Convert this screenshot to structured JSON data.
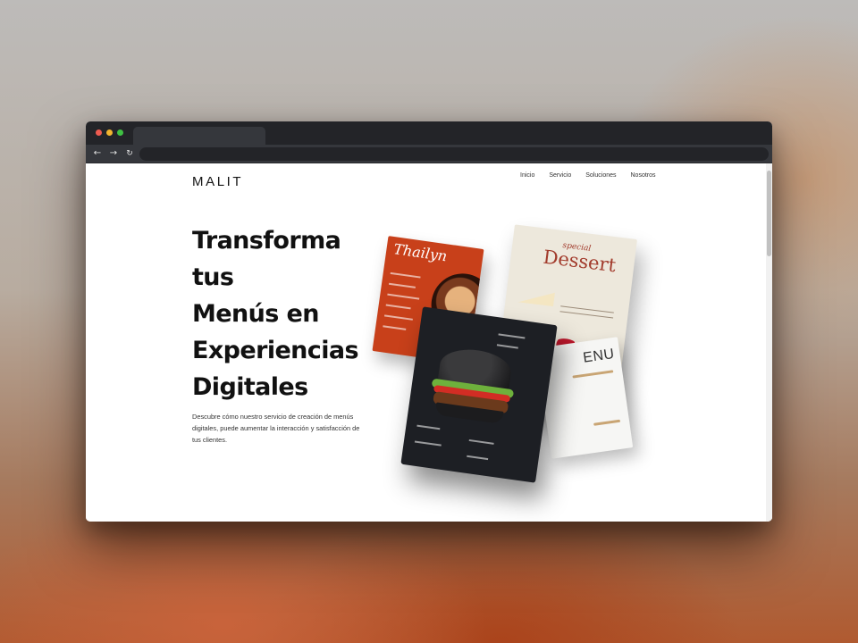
{
  "browser": {
    "back_icon": "arrow-left-icon",
    "forward_icon": "arrow-right-icon",
    "reload_icon": "reload-icon"
  },
  "site": {
    "logo": "MALIT",
    "nav": [
      "Inicio",
      "Servicio",
      "Soluciones",
      "Nosotros"
    ]
  },
  "hero": {
    "headline_lines": [
      "Transforma",
      "tus",
      "Menús en",
      "Experiencias",
      "Digitales"
    ],
    "description": "Descubre cómo nuestro servicio de creación de menús digitales, puede aumentar la interacción y satisfacción de tus clientes."
  },
  "mockups": {
    "thai_title": "Thailyn",
    "dessert_special": "special",
    "dessert_title": "Dessert",
    "white_menu_title": "ENU"
  },
  "colors": {
    "thai_red": "#c8401a",
    "dessert_red": "#a23b2c",
    "burger_dark": "#1d1f24"
  }
}
